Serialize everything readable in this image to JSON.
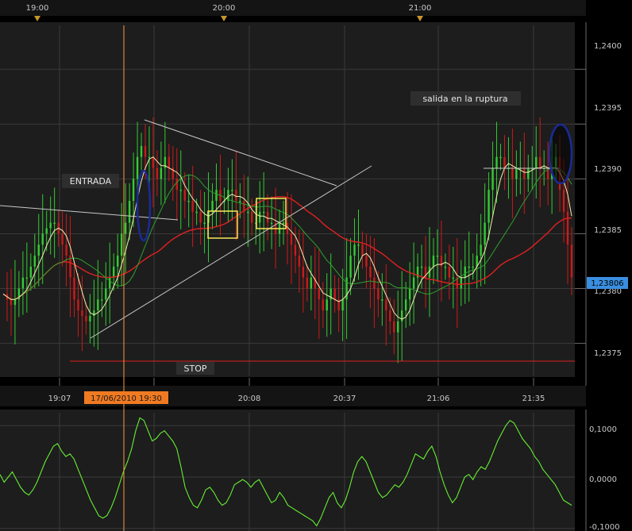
{
  "colors": {
    "background": "#000000",
    "panel": "#1d1d1d",
    "grid": "#3a3a3a",
    "bull": "#33cc33",
    "bear": "#cc1a1a",
    "ma_fast": "#f3f0b0",
    "ma_mid": "#2ea02e",
    "ma_slow": "#e02020",
    "oscillator": "#66ee33",
    "vline": "#ff9a3a",
    "highlight_box": "#f5e85a",
    "ellipse": "#1a2a9a",
    "trendline": "#c8c8c8",
    "price_badge": "#3a8ee0",
    "date_badge": "#f07a22"
  },
  "top_axis": {
    "labels": [
      "19:00",
      "20:00",
      "21:00"
    ]
  },
  "bottom_axis": {
    "labels": [
      "19:07",
      "20:08",
      "20:37",
      "21:06",
      "21:35"
    ],
    "cursor_label": "17/06/2010 19:30"
  },
  "price_axis": {
    "labels": [
      "1,2400",
      "1,2395",
      "1,2390",
      "1,2385",
      "1,2380",
      "1,2375"
    ],
    "current_price": "1,23806"
  },
  "osc_axis": {
    "labels": [
      "0,1000",
      "0,0000",
      "-0,1000"
    ]
  },
  "annotations": {
    "entry": "ENTRADA",
    "stop": "STOP",
    "exit": "salida en la ruptura"
  },
  "chart_data": [
    {
      "type": "candlestick",
      "title": "",
      "x_start": "18:50",
      "x_step_minutes": 1,
      "ylim": [
        1.2372,
        1.2404
      ],
      "grid": true,
      "close": [
        1.23795,
        1.2379,
        1.23785,
        1.2379,
        1.238,
        1.2381,
        1.2381,
        1.2382,
        1.2383,
        1.2384,
        1.2385,
        1.23855,
        1.2386,
        1.2386,
        1.2385,
        1.2384,
        1.2383,
        1.2381,
        1.2379,
        1.2378,
        1.23775,
        1.2377,
        1.23775,
        1.2378,
        1.2379,
        1.2379,
        1.238,
        1.2381,
        1.2382,
        1.2383,
        1.2385,
        1.2386,
        1.2388,
        1.239,
        1.2392,
        1.2393,
        1.2392,
        1.2392,
        1.2391,
        1.239,
        1.2391,
        1.2392,
        1.2391,
        1.239,
        1.2389,
        1.2389,
        1.2388,
        1.2388,
        1.2387,
        1.2387,
        1.2386,
        1.2386,
        1.2387,
        1.2388,
        1.2389,
        1.2388,
        1.2388,
        1.2389,
        1.2389,
        1.2388,
        1.2388,
        1.2387,
        1.2387,
        1.2386,
        1.2386,
        1.2387,
        1.2387,
        1.2386,
        1.2386,
        1.2385,
        1.2386,
        1.2386,
        1.2385,
        1.2384,
        1.2383,
        1.2382,
        1.2381,
        1.238,
        1.2381,
        1.238,
        1.2379,
        1.2378,
        1.2379,
        1.238,
        1.2379,
        1.2378,
        1.2379,
        1.2381,
        1.2383,
        1.2384,
        1.2384,
        1.2383,
        1.2382,
        1.2381,
        1.238,
        1.2379,
        1.2379,
        1.2378,
        1.2377,
        1.2376,
        1.2377,
        1.2378,
        1.2379,
        1.238,
        1.2381,
        1.2382,
        1.2382,
        1.2381,
        1.2382,
        1.2383,
        1.2383,
        1.2382,
        1.2382,
        1.2381,
        1.2381,
        1.238,
        1.2381,
        1.2382,
        1.2382,
        1.2382,
        1.2383,
        1.2384,
        1.2386,
        1.2389,
        1.2391,
        1.2392,
        1.2392,
        1.2391,
        1.2391,
        1.239,
        1.2391,
        1.2391,
        1.239,
        1.2391,
        1.2391,
        1.2392,
        1.2391,
        1.2391,
        1.239,
        1.2391,
        1.2392,
        1.2389,
        1.2387,
        1.2384,
        1.2381
      ],
      "series": [
        {
          "kind": "moving-average",
          "style": "fast"
        },
        {
          "kind": "moving-average",
          "style": "mid"
        },
        {
          "kind": "moving-average",
          "style": "slow"
        }
      ],
      "levels": {
        "stop": 1.23741,
        "exit_breakout": 1.239,
        "entry_box": [
          [
            1.2384,
            1.2387
          ],
          [
            1.2385,
            1.2388
          ]
        ]
      },
      "vertical_marker_time": "19:30"
    },
    {
      "type": "line",
      "title": "",
      "ylim": [
        -0.105,
        0.125
      ],
      "ticks": [
        0.1,
        0.0,
        -0.1
      ],
      "values": [
        0.005,
        -0.01,
        0.0,
        0.01,
        -0.005,
        -0.02,
        -0.03,
        -0.035,
        -0.025,
        -0.01,
        0.01,
        0.03,
        0.045,
        0.06,
        0.065,
        0.05,
        0.04,
        0.045,
        0.035,
        0.015,
        -0.005,
        -0.025,
        -0.045,
        -0.06,
        -0.075,
        -0.08,
        -0.075,
        -0.06,
        -0.04,
        -0.015,
        0.01,
        0.03,
        0.055,
        0.09,
        0.115,
        0.11,
        0.09,
        0.07,
        0.075,
        0.085,
        0.09,
        0.08,
        0.07,
        0.055,
        0.02,
        -0.02,
        -0.04,
        -0.055,
        -0.06,
        -0.045,
        -0.025,
        -0.02,
        -0.03,
        -0.045,
        -0.055,
        -0.05,
        -0.035,
        -0.015,
        -0.01,
        -0.005,
        -0.01,
        -0.02,
        -0.01,
        -0.005,
        -0.02,
        -0.035,
        -0.05,
        -0.045,
        -0.03,
        -0.04,
        -0.055,
        -0.06,
        -0.065,
        -0.07,
        -0.075,
        -0.08,
        -0.085,
        -0.095,
        -0.08,
        -0.06,
        -0.04,
        -0.03,
        -0.05,
        -0.06,
        -0.045,
        -0.02,
        0.01,
        0.03,
        0.04,
        0.03,
        0.01,
        -0.01,
        -0.03,
        -0.04,
        -0.035,
        -0.025,
        -0.015,
        -0.02,
        -0.01,
        0.005,
        0.025,
        0.045,
        0.04,
        0.035,
        0.05,
        0.06,
        0.04,
        0.01,
        -0.015,
        -0.035,
        -0.05,
        -0.04,
        -0.02,
        0.0,
        0.005,
        -0.005,
        0.01,
        0.02,
        0.015,
        0.03,
        0.05,
        0.07,
        0.085,
        0.1,
        0.11,
        0.105,
        0.09,
        0.075,
        0.065,
        0.055,
        0.04,
        0.03,
        0.015,
        0.005,
        -0.005,
        -0.015,
        -0.03,
        -0.045,
        -0.05,
        -0.055
      ]
    }
  ]
}
